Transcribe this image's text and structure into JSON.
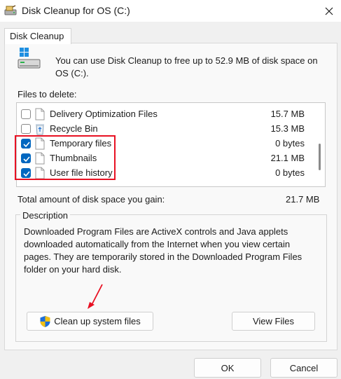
{
  "window": {
    "title": "Disk Cleanup for OS (C:)"
  },
  "tab": {
    "label": "Disk Cleanup"
  },
  "intro": "You can use Disk Cleanup to free up to 52.9 MB of disk space on OS (C:).",
  "files_to_delete_label": "Files to delete:",
  "files": [
    {
      "name": "Delivery Optimization Files",
      "size": "15.7 MB",
      "checked": false,
      "icon": "file-icon"
    },
    {
      "name": "Recycle Bin",
      "size": "15.3 MB",
      "checked": false,
      "icon": "recycle-bin-icon"
    },
    {
      "name": "Temporary files",
      "size": "0 bytes",
      "checked": true,
      "icon": "file-icon"
    },
    {
      "name": "Thumbnails",
      "size": "21.1 MB",
      "checked": true,
      "icon": "file-icon"
    },
    {
      "name": "User file history",
      "size": "0 bytes",
      "checked": true,
      "icon": "file-icon"
    }
  ],
  "total": {
    "label": "Total amount of disk space you gain:",
    "value": "21.7 MB"
  },
  "description": {
    "title": "Description",
    "text": "Downloaded Program Files are ActiveX controls and Java applets downloaded automatically from the Internet when you view certain pages. They are temporarily stored in the Downloaded Program Files folder on your hard disk."
  },
  "buttons": {
    "cleanup": "Clean up system files",
    "view_files": "View Files",
    "ok": "OK",
    "cancel": "Cancel"
  },
  "colors": {
    "accent": "#0067c0",
    "annotation": "#e81123"
  }
}
